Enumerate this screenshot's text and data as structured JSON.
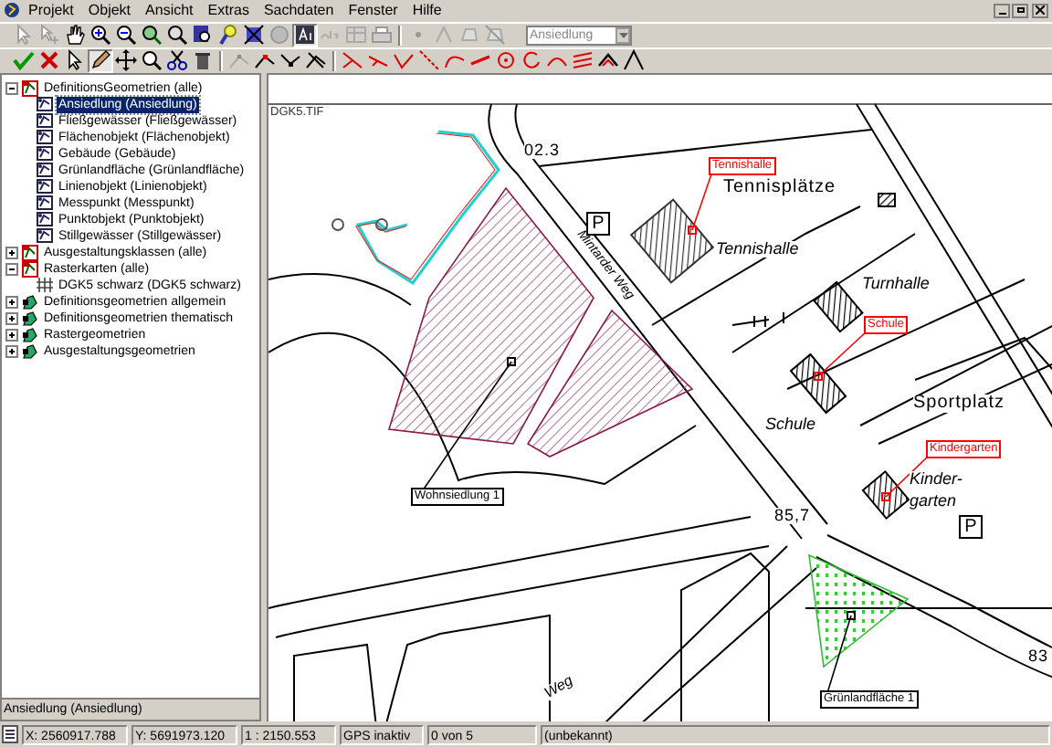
{
  "menu": [
    "Projekt",
    "Objekt",
    "Ansicht",
    "Extras",
    "Sachdaten",
    "Fenster",
    "Hilfe"
  ],
  "layer_combo": {
    "value": "Ansiedlung"
  },
  "tree": [
    {
      "label": "DefinitionsGeometrien (alle)",
      "kind": "group",
      "expanded": true,
      "selected": false,
      "children": [
        {
          "label": "Ansiedlung (Ansiedlung)",
          "kind": "layer",
          "selected": true
        },
        {
          "label": "Fließgewässer (Fließgewässer)",
          "kind": "layer",
          "selected": false
        },
        {
          "label": "Flächenobjekt (Flächenobjekt)",
          "kind": "layer",
          "selected": false
        },
        {
          "label": "Gebäude (Gebäude)",
          "kind": "layer",
          "selected": false
        },
        {
          "label": "Grünlandfläche (Grünlandfläche)",
          "kind": "layer",
          "selected": false
        },
        {
          "label": "Linienobjekt (Linienobjekt)",
          "kind": "layer",
          "selected": false
        },
        {
          "label": "Messpunkt (Messpunkt)",
          "kind": "layer",
          "selected": false
        },
        {
          "label": "Punktobjekt (Punktobjekt)",
          "kind": "layer",
          "selected": false
        },
        {
          "label": "Stillgewässer (Stillgewässer)",
          "kind": "layer",
          "selected": false
        }
      ]
    },
    {
      "label": "Ausgestaltungsklassen (alle)",
      "kind": "group",
      "expanded": false,
      "selected": false
    },
    {
      "label": "Rasterkarten (alle)",
      "kind": "group",
      "expanded": true,
      "selected": false,
      "children": [
        {
          "label": "DGK5 schwarz (DGK5 schwarz)",
          "kind": "raster",
          "selected": false
        }
      ]
    },
    {
      "label": "Definitionsgeometrien allgemein",
      "kind": "theme",
      "expanded": false,
      "selected": false
    },
    {
      "label": "Definitionsgeometrien thematisch",
      "kind": "theme",
      "expanded": false,
      "selected": false
    },
    {
      "label": "Rastergeometrien",
      "kind": "theme",
      "expanded": false,
      "selected": false
    },
    {
      "label": "Ausgestaltungsgeometrien",
      "kind": "theme",
      "expanded": false,
      "selected": false
    }
  ],
  "tree_status": "Ansiedlung (Ansiedlung)",
  "map": {
    "image_name": "DGK5.TIF",
    "texts": [
      {
        "text": "02.3",
        "kind": "upright"
      },
      {
        "text": "Tennisplätze",
        "kind": "upright"
      },
      {
        "text": "Tennishalle",
        "kind": "italic"
      },
      {
        "text": "Turnhalle",
        "kind": "italic"
      },
      {
        "text": "Sportplatz",
        "kind": "upright"
      },
      {
        "text": "Schule",
        "kind": "italic"
      },
      {
        "text": "Kinder-",
        "kind": "italic"
      },
      {
        "text": "garten",
        "kind": "italic"
      },
      {
        "text": "85,7",
        "kind": "upright"
      },
      {
        "text": "83",
        "kind": "upright"
      },
      {
        "text": "Mintarder Weg",
        "kind": "italic"
      },
      {
        "text": "Weg",
        "kind": "italic"
      }
    ],
    "parking_signs": [
      "P",
      "P"
    ],
    "annotations": [
      {
        "text": "Tennishalle",
        "color": "#ff0000"
      },
      {
        "text": "Schule",
        "color": "#ff0000"
      },
      {
        "text": "Kindergarten",
        "color": "#ff0000"
      },
      {
        "text": "Wohnsiedlung 1",
        "color": "#000000"
      },
      {
        "text": "Grünlandfläche 1",
        "color": "#000000"
      }
    ]
  },
  "status_bar": [
    "X: 2560917.788",
    "Y: 5691973.120",
    "1 : 2150.553",
    "GPS inaktiv",
    "0 von 5",
    "(unbekannt)"
  ]
}
